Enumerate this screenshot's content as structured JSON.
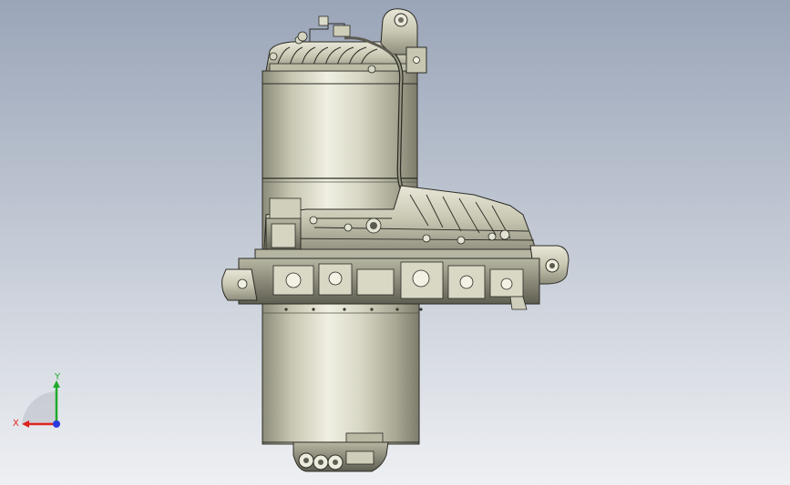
{
  "colors": {
    "background_top": "#9aa5b8",
    "background_bottom": "#eef0f3",
    "housing_light": "#e7e6d6",
    "housing_mid": "#c9c8b3",
    "housing_dark": "#7d7c6c",
    "line": "#2b2b25",
    "axis_x": "#e0241c",
    "axis_y": "#1faa2a",
    "axis_z": "#2a3adf"
  },
  "triad": {
    "x_label": "X",
    "y_label": "Y"
  }
}
